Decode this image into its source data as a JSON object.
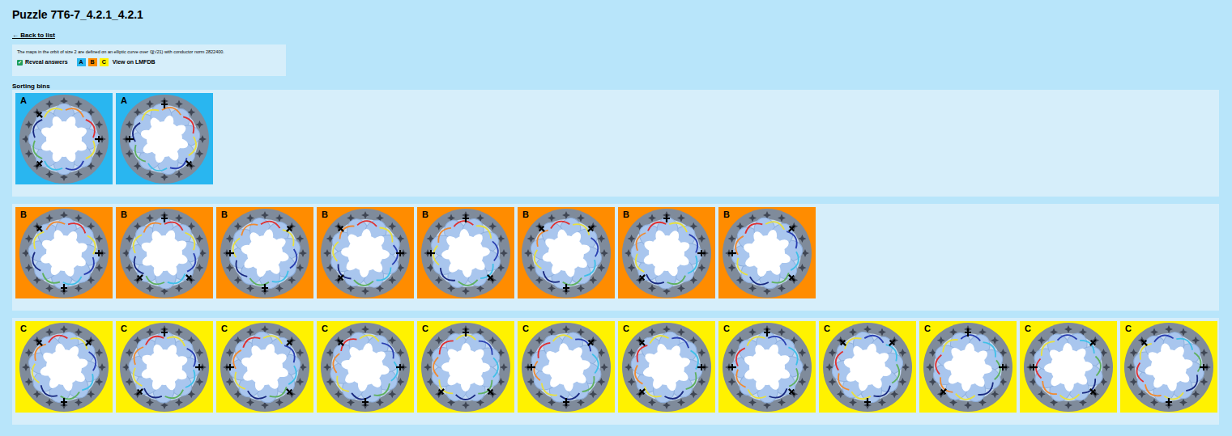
{
  "title": "Puzzle 7T6-7_4.2.1_4.2.1",
  "back_link": "← Back to list",
  "info": {
    "text": "The maps in the orbit of size 2 are defined on an elliptic curve over ℚ(√21) with conductor norm 2822400.",
    "checkbox": {
      "label": "Reveal answers",
      "checked": true
    },
    "badges": [
      {
        "label": "A",
        "color": "#29b6f0"
      },
      {
        "label": "B",
        "color": "#ff8c00"
      },
      {
        "label": "C",
        "color": "#fff200"
      }
    ],
    "link": "View on LMFDB"
  },
  "section_title": "Sorting bins",
  "bins": [
    {
      "label": "A",
      "color": "#29b6f0",
      "cards": [
        "A",
        "A"
      ]
    },
    {
      "label": "B",
      "color": "#ff8c00",
      "cards": [
        "B",
        "B",
        "B",
        "B",
        "B",
        "B",
        "B",
        "B"
      ]
    },
    {
      "label": "C",
      "color": "#fff200",
      "cards": [
        "C",
        "C",
        "C",
        "C",
        "C",
        "C",
        "C",
        "C",
        "C",
        "C",
        "C",
        "C"
      ]
    }
  ]
}
